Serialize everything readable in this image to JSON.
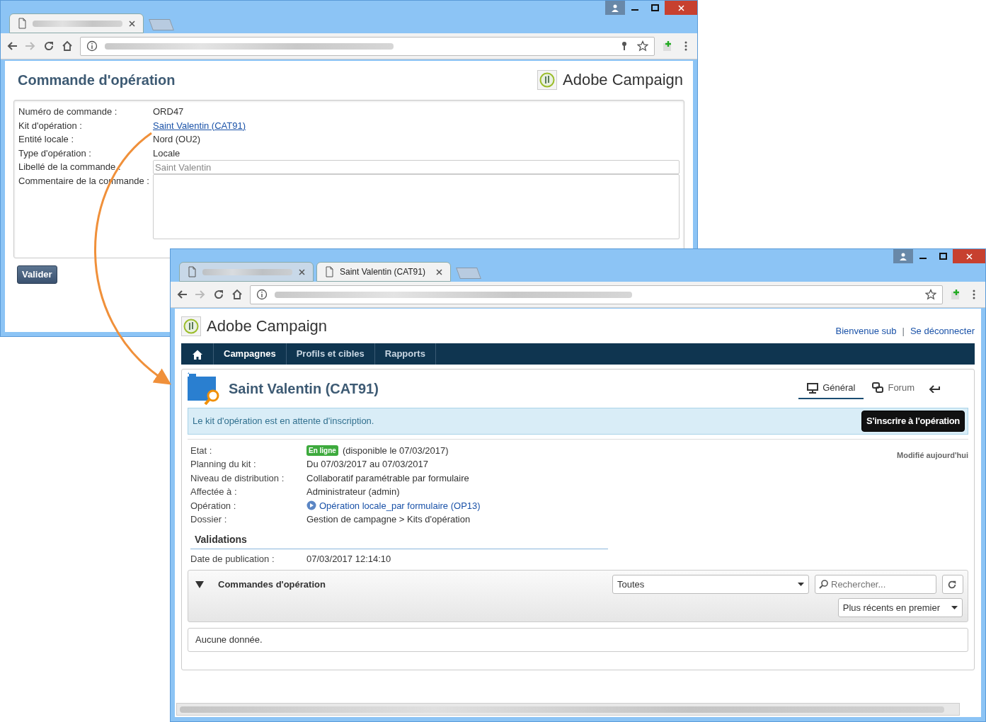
{
  "order_window": {
    "tabs": [
      {
        "selected": true
      }
    ],
    "title": "Commande d'opération",
    "brand": "Adobe Campaign",
    "fields": [
      {
        "label": "Numéro de commande :",
        "value": "ORD47",
        "kind": "text"
      },
      {
        "label": "Kit d'opération :",
        "value": "Saint Valentin (CAT91)",
        "kind": "link"
      },
      {
        "label": "Entité locale :",
        "value": "Nord (OU2)",
        "kind": "text"
      },
      {
        "label": "Type d'opération :",
        "value": "Locale",
        "kind": "text"
      },
      {
        "label": "Libellé de la commande :",
        "value": "Saint Valentin",
        "kind": "input"
      },
      {
        "label": "Commentaire de la commande :",
        "kind": "textarea"
      }
    ],
    "button": "Valider"
  },
  "kit_window": {
    "tabs": [
      {
        "selected": false
      },
      {
        "title": "Saint Valentin (CAT91)",
        "selected": true
      }
    ],
    "brand": "Adobe Campaign",
    "welcome": "Bienvenue sub",
    "separator": "|",
    "logout": "Se déconnecter",
    "nav": [
      {
        "label": "Campagnes",
        "selected": true
      },
      {
        "label": "Profils et cibles",
        "selected": false
      },
      {
        "label": "Rapports",
        "selected": false
      }
    ],
    "title": "Saint Valentin (CAT91)",
    "view_tabs": [
      {
        "label": "Général",
        "kind": "general",
        "selected": true
      },
      {
        "label": "Forum",
        "kind": "forum",
        "selected": false
      }
    ],
    "alert": "Le kit d'opération est en attente d'inscription.",
    "register_button": "S'inscrire à l'opération",
    "modified": "Modifié aujourd'hui",
    "details": [
      {
        "label": "Etat :",
        "kind": "status",
        "badge": "En ligne",
        "value": "(disponible le 07/03/2017)"
      },
      {
        "label": "Planning du kit :",
        "kind": "text",
        "value": "Du 07/03/2017 au 07/03/2017"
      },
      {
        "label": "Niveau de distribution :",
        "kind": "text",
        "value": "Collaboratif paramétrable par formulaire"
      },
      {
        "label": "Affectée à :",
        "kind": "text",
        "value": "Administrateur (admin)"
      },
      {
        "label": "Opération :",
        "kind": "link",
        "value": "Opération locale_par formulaire (OP13)"
      },
      {
        "label": "Dossier :",
        "kind": "text",
        "value": "Gestion de campagne > Kits d'opération"
      }
    ],
    "section": "Validations",
    "publication": {
      "label": "Date de publication :",
      "value": "07/03/2017 12:14:10"
    },
    "orders_panel": {
      "title": "Commandes d'opération",
      "expanded": true,
      "filter": "Toutes",
      "search_placeholder": "Rechercher...",
      "sort": "Plus récents en premier",
      "empty": "Aucune donnée."
    }
  }
}
